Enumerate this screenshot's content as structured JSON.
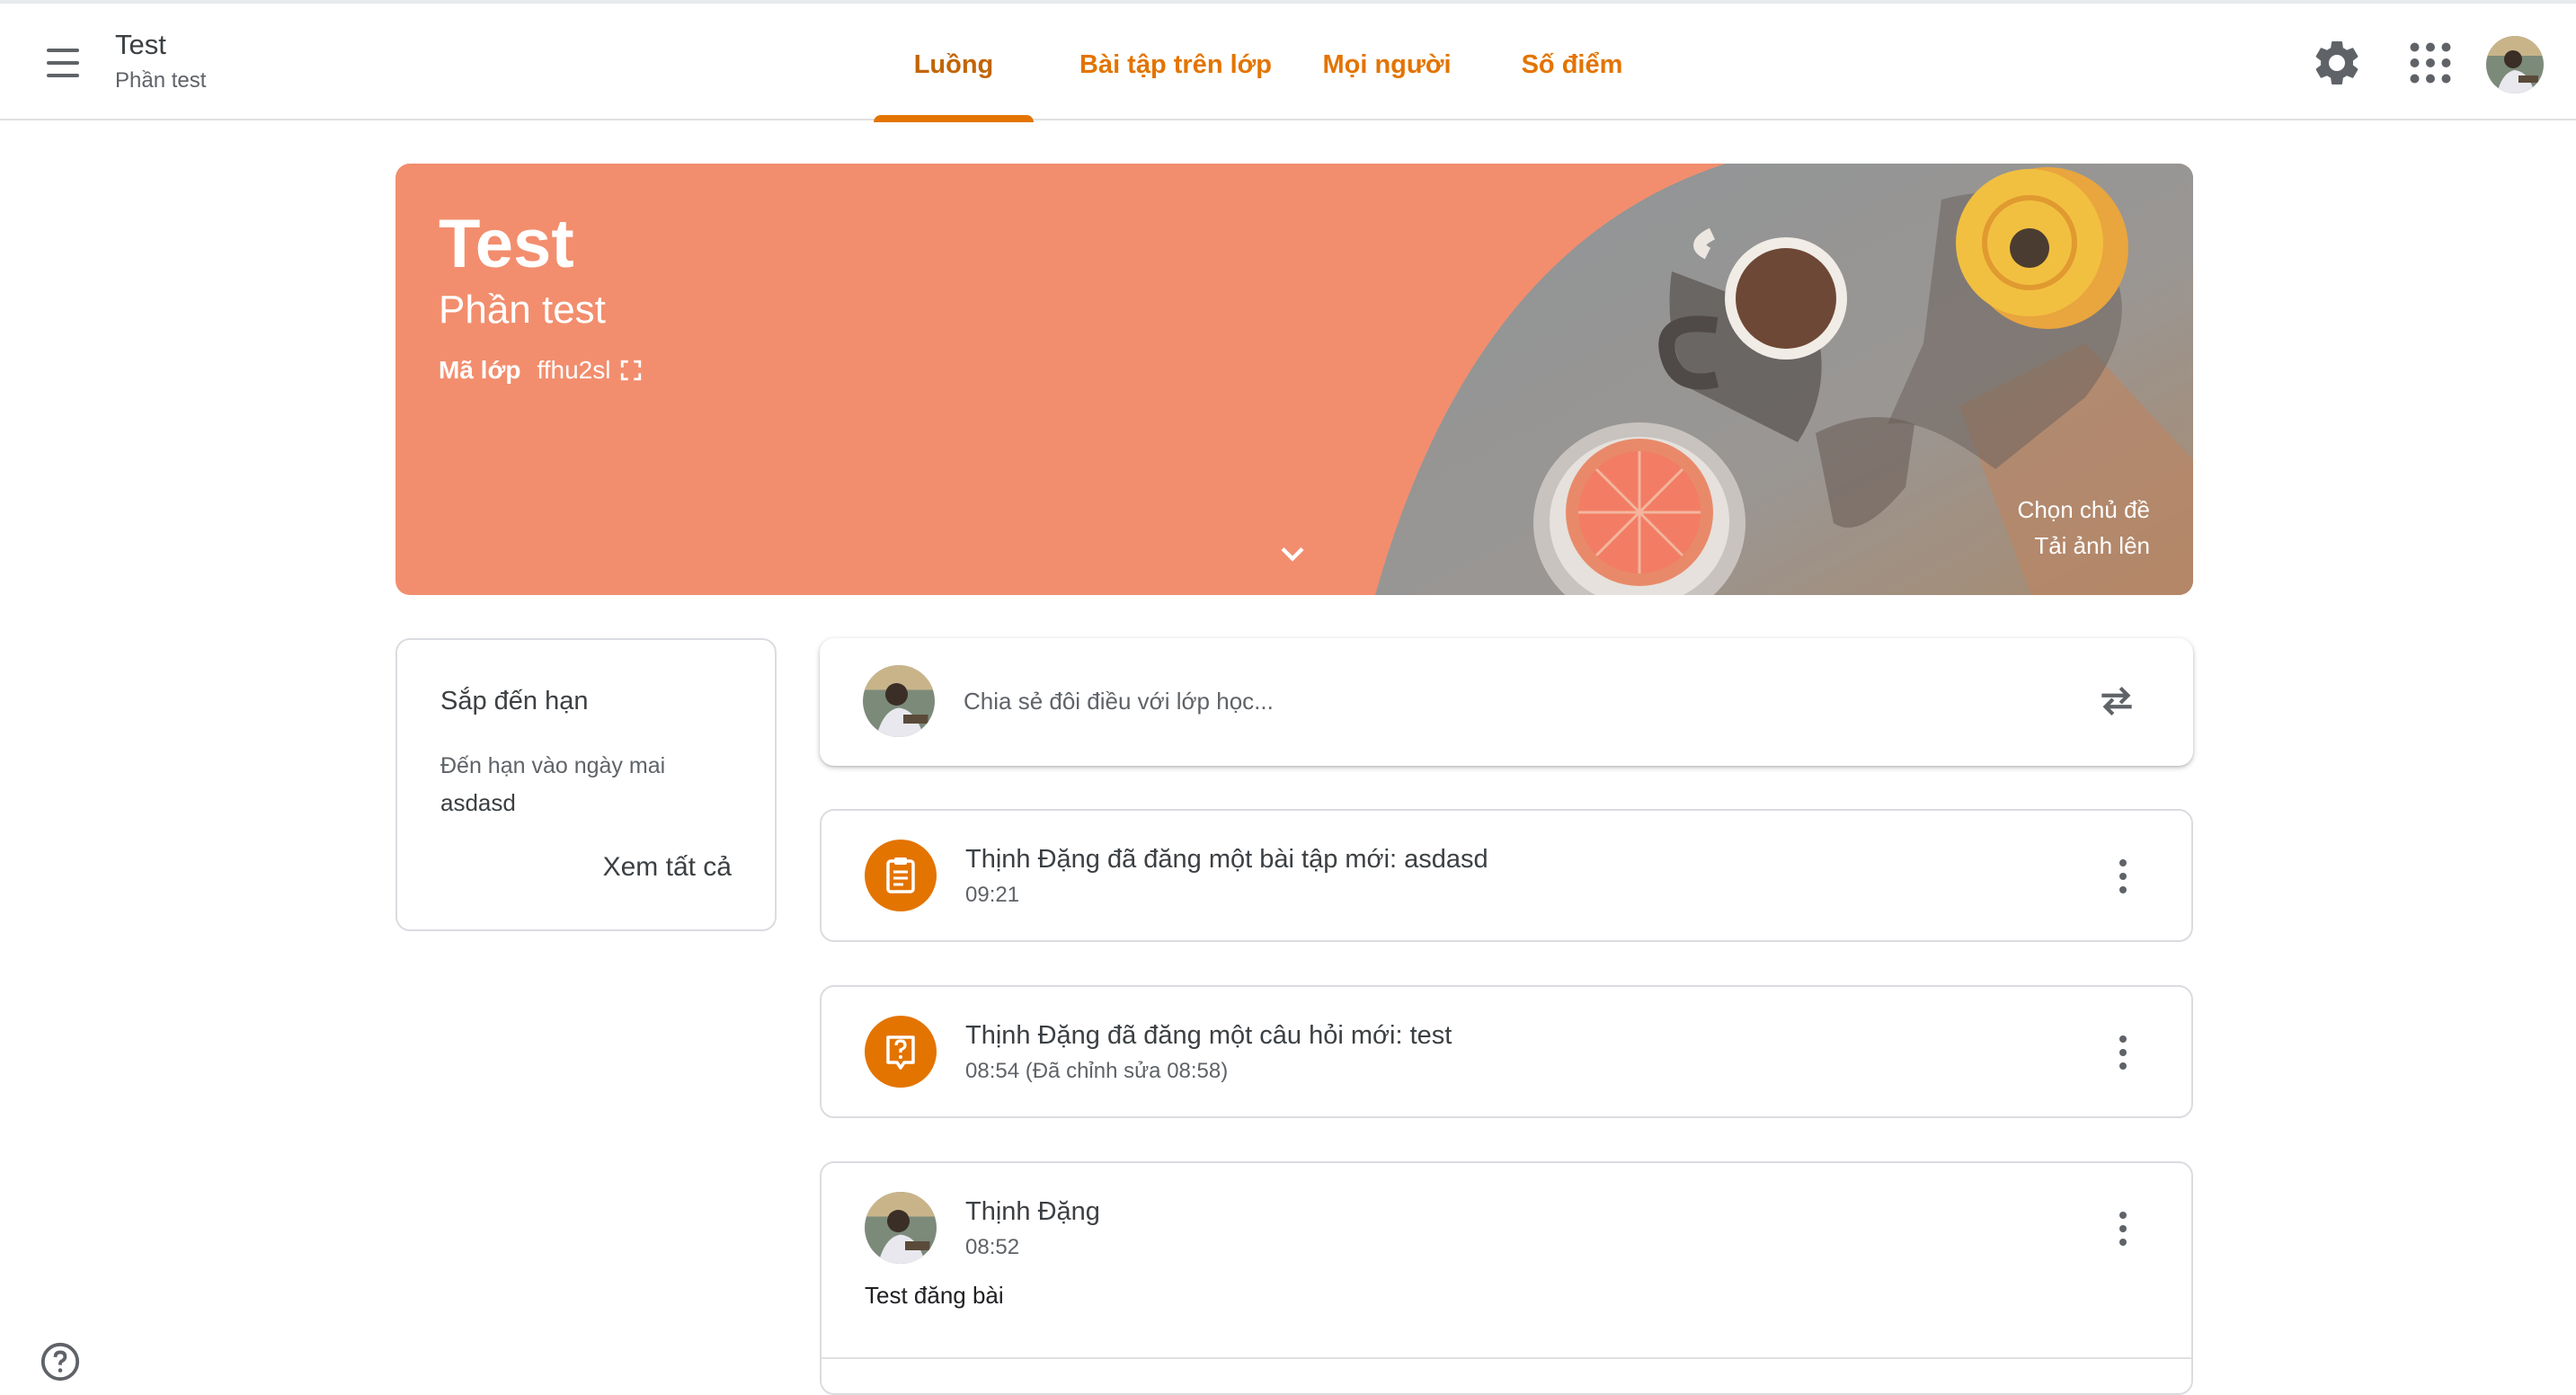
{
  "header": {
    "class_title": "Test",
    "class_section": "Phần test",
    "tabs": [
      {
        "label": "Luồng",
        "active": true
      },
      {
        "label": "Bài tập trên lớp",
        "active": false
      },
      {
        "label": "Mọi người",
        "active": false
      },
      {
        "label": "Số điểm",
        "active": false
      }
    ],
    "icons": [
      "menu-icon",
      "gear-icon",
      "apps-grid-icon",
      "account-avatar"
    ]
  },
  "banner": {
    "title": "Test",
    "section": "Phần test",
    "class_code_label": "Mã lớp",
    "class_code": "ffhu2sl",
    "select_theme": "Chọn chủ đề",
    "upload_photo": "Tải ảnh lên"
  },
  "upcoming": {
    "title": "Sắp đến hạn",
    "due_label": "Đến hạn vào ngày mai",
    "item": "asdasd",
    "view_all": "Xem tất cả"
  },
  "share": {
    "placeholder": "Chia sẻ đôi điều với lớp học..."
  },
  "stream": [
    {
      "type": "assignment",
      "title": "Thịnh Đặng đã đăng một bài tập mới: asdasd",
      "time": "09:21"
    },
    {
      "type": "question",
      "title": "Thịnh Đặng đã đăng một câu hỏi mới: test",
      "time": "08:54 (Đã chỉnh sửa 08:58)"
    },
    {
      "type": "announcement",
      "author": "Thịnh Đặng",
      "time": "08:52",
      "body": "Test đăng bài"
    }
  ],
  "colors": {
    "accent": "#e37400",
    "banner": "#f28e6e",
    "text": "#3c4043",
    "muted": "#5f6368"
  }
}
